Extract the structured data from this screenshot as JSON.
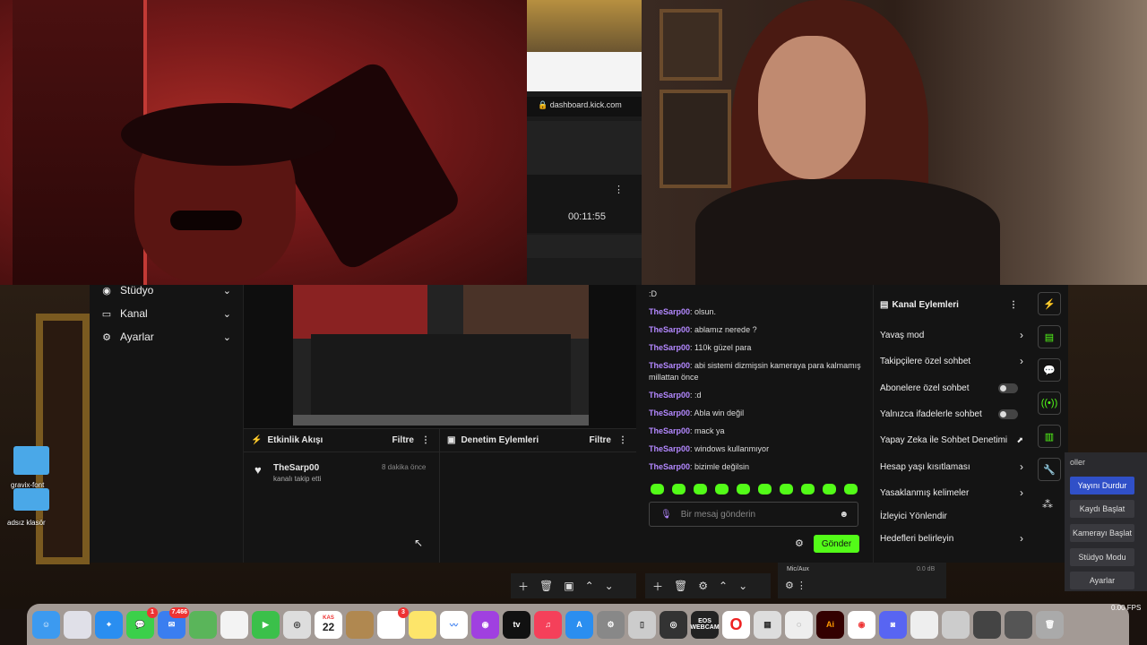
{
  "browser": {
    "url": "dashboard.kick.com",
    "timer": "00:11:55"
  },
  "sidebar": {
    "items": [
      {
        "label": "Stüdyo",
        "icon": "studio-icon"
      },
      {
        "label": "Kanal",
        "icon": "channel-icon"
      },
      {
        "label": "Ayarlar",
        "icon": "settings-icon"
      }
    ]
  },
  "activity": {
    "title": "Etkinlik Akışı",
    "filter": "Filtre",
    "event_user": "TheSarp00",
    "event_text": "kanalı takip etti",
    "event_time": "8 dakika önce"
  },
  "moderation": {
    "title": "Denetim Eylemleri",
    "filter": "Filtre"
  },
  "chat": {
    "top_text": ":D",
    "messages": [
      {
        "user": "TheSarp00",
        "text": ": olsun."
      },
      {
        "user": "TheSarp00",
        "text": ": ablamız nerede ?"
      },
      {
        "user": "TheSarp00",
        "text": ": 110k güzel para"
      },
      {
        "user": "TheSarp00",
        "text": ": abi sistemi dizmişsin kameraya para kalmamış millattan önce"
      },
      {
        "user": "TheSarp00",
        "text": ": :d"
      },
      {
        "user": "TheSarp00",
        "text": ": Abla win değil"
      },
      {
        "user": "TheSarp00",
        "text": ": mack ya"
      },
      {
        "user": "TheSarp00",
        "text": ": windows kullanmıyor"
      },
      {
        "user": "TheSarp00",
        "text": ": bizimle değilsin"
      }
    ],
    "placeholder": "Bir mesaj gönderin",
    "send_label": "Gönder"
  },
  "channel_actions": {
    "title": "Kanal Eylemleri",
    "items": [
      {
        "label": "Yavaş mod",
        "control": "arrow"
      },
      {
        "label": "Takipçilere özel sohbet",
        "control": "arrow"
      },
      {
        "label": "Abonelere özel sohbet",
        "control": "toggle"
      },
      {
        "label": "Yalnızca ifadelerle sohbet",
        "control": "toggle"
      },
      {
        "label": "Yapay Zeka ile Sohbet Denetimi",
        "control": "chart"
      },
      {
        "label": "Hesap yaşı kısıtlaması",
        "control": "arrow"
      },
      {
        "label": "Yasaklanmış kelimeler",
        "control": "arrow"
      },
      {
        "label": "İzleyici Yönlendir",
        "control": "none"
      },
      {
        "label": "Hedefleri belirleyin",
        "control": "arrow"
      }
    ]
  },
  "obs": {
    "header": "oller",
    "buttons": [
      "Yayını Durdur",
      "Kaydı Başlat",
      "Kamerayı Başlat",
      "Stüdyo Modu",
      "Ayarlar"
    ],
    "mic_label": "Mic/Aux",
    "mic_db": "0.0 dB",
    "fps": "0.00 FPS"
  },
  "desktop": {
    "folders": [
      "gravix-font",
      "adsız klasör"
    ]
  },
  "dock": {
    "calendar_month": "KAS",
    "calendar_day": "22",
    "messages_badge": "1",
    "mail_badge": "7.466",
    "reminders_badge": "3",
    "webcam_label": "EOS WEBCAM",
    "tv_label": "tv"
  },
  "colors": {
    "kick_green": "#53fc18",
    "username": "#b388ff",
    "obs_active": "#3050c8"
  }
}
